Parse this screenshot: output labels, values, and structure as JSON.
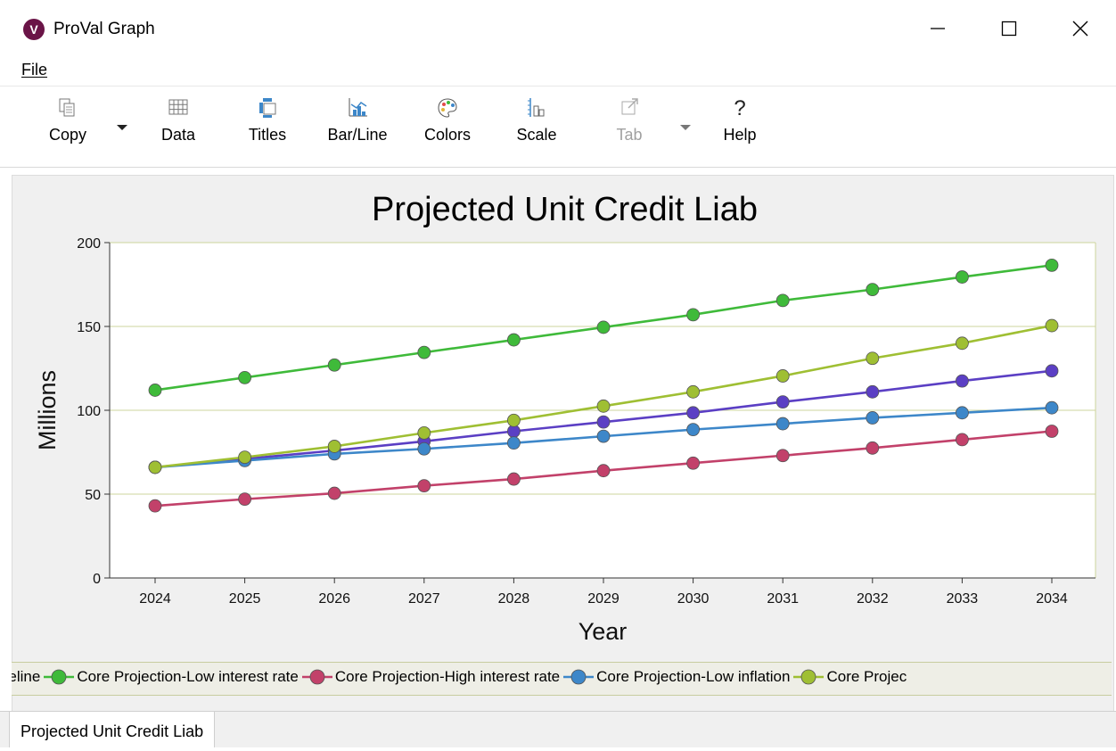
{
  "window": {
    "title": "ProVal Graph",
    "icon_letter": "V"
  },
  "menu": {
    "file_label": "File"
  },
  "toolbar": {
    "copy": "Copy",
    "data": "Data",
    "titles": "Titles",
    "barline": "Bar/Line",
    "colors": "Colors",
    "scale": "Scale",
    "tab": "Tab",
    "help": "Help"
  },
  "colors": {
    "accent_bg": "#f0f0f0",
    "grid": "#cdd49c"
  },
  "chart_data": {
    "type": "line",
    "title": "Projected Unit Credit Liab",
    "xlabel": "Year",
    "ylabel": "Millions",
    "ylim": [
      0,
      200
    ],
    "yticks": [
      0,
      50,
      100,
      150,
      200
    ],
    "x": [
      "2024",
      "2025",
      "2026",
      "2027",
      "2028",
      "2029",
      "2030",
      "2031",
      "2032",
      "2033",
      "2034"
    ],
    "grid": "horizontal",
    "legend_position": "bottom",
    "series": [
      {
        "name": "Core Projection-Baseline",
        "color": "#5b3fc4",
        "values": [
          66,
          71,
          76,
          81.5,
          87.5,
          93,
          98.5,
          105,
          111,
          117.5,
          123.5
        ]
      },
      {
        "name": "Core Projection-Low interest rate",
        "color": "#3fba3a",
        "values": [
          112,
          119.5,
          127,
          134.5,
          142,
          149.5,
          157,
          165.5,
          172,
          179.5,
          186.5
        ]
      },
      {
        "name": "Core Projection-High interest rate",
        "color": "#c2416a",
        "values": [
          43,
          47,
          50.5,
          55,
          59,
          64,
          68.5,
          73,
          77.5,
          82.5,
          87.5
        ]
      },
      {
        "name": "Core Projection-Low inflation",
        "color": "#3d87c9",
        "values": [
          66,
          70,
          74,
          77,
          80.5,
          84.5,
          88.5,
          92,
          95.5,
          98.5,
          101.5
        ]
      },
      {
        "name": "Core Projection-High inflation",
        "color": "#9fbf33",
        "values": [
          66,
          72,
          78.5,
          86.5,
          94,
          102.5,
          111,
          120.5,
          131,
          140,
          150.5
        ]
      }
    ]
  },
  "legend": {
    "items": [
      "n-Baseline",
      "Core Projection-Low interest rate",
      "Core Projection-High interest rate",
      "Core Projection-Low inflation",
      "Core Projec"
    ]
  },
  "tabs": {
    "active": "Projected Unit Credit Liab"
  }
}
